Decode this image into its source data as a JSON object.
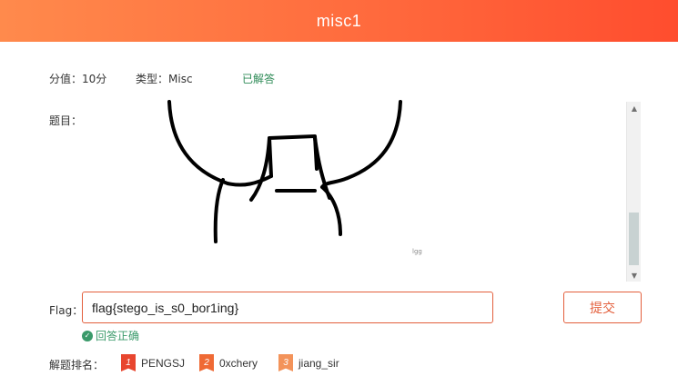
{
  "header": {
    "title": "misc1"
  },
  "meta": {
    "score": "分值：10分",
    "type": "类型：Misc",
    "status": "已解答"
  },
  "question": {
    "label": "题目：",
    "watermark": "lgg"
  },
  "flag": {
    "label": "Flag：",
    "value": "flag{stego_is_s0_bor1ing}"
  },
  "submit": {
    "label": "提交"
  },
  "result": {
    "text": "回答正确"
  },
  "ranking": {
    "label": "解题排名：",
    "items": [
      {
        "rank": "1",
        "name": "PENGSJ",
        "color": "#e8462f"
      },
      {
        "rank": "2",
        "name": "0xchery",
        "color": "#ef6a35"
      },
      {
        "rank": "3",
        "name": "jiang_sir",
        "color": "#f3935a"
      }
    ]
  },
  "colors": {
    "accent": "#e35f3c",
    "success": "#3a9a6a",
    "header_start": "#ff8a4c",
    "header_end": "#ff4d2e"
  },
  "icons": {
    "check": "check-circle-icon",
    "up": "scroll-up-icon",
    "down": "scroll-down-icon"
  }
}
